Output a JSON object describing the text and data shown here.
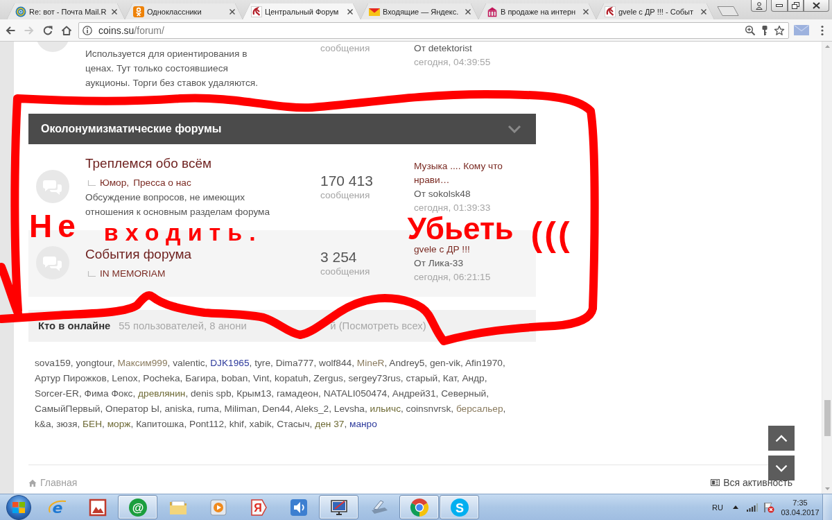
{
  "browser": {
    "tabs": [
      {
        "kind": "mail",
        "title": "Re: вот - Почта Mail.R",
        "selected": false
      },
      {
        "kind": "ok",
        "title": "Одноклассники",
        "selected": false
      },
      {
        "kind": "coins",
        "title": "Центральный Форум",
        "selected": true
      },
      {
        "kind": "ymail",
        "title": "Входящие — Яндекс.",
        "selected": false
      },
      {
        "kind": "shop",
        "title": "В продаже на интерн",
        "selected": false
      },
      {
        "kind": "coins",
        "title": "gvele с ДР !!! - Событ",
        "selected": false
      }
    ],
    "toolbar": {
      "forward_disabled": true,
      "url_host": "coins.su",
      "url_path": "/forum/"
    }
  },
  "page": {
    "previous_forum": {
      "description": "Используется для ориентирования в ценах. Тут только состоявшиеся аукционы. Торги без ставок удаляются.",
      "posts_label": "сообщения",
      "last_author": "От detektorist",
      "last_time": "сегодня, 04:39:55"
    },
    "category": {
      "title": "Околонумизматические форумы",
      "expanded": true
    },
    "forums": [
      {
        "title": "Треплемся обо всём",
        "subforums": [
          "Юмор",
          "Пресса о нас"
        ],
        "description": "Обсуждение вопросов, не имеющих отношения к основным разделам форума",
        "posts": "170 413",
        "posts_label": "сообщения",
        "last_topic": "Музыка .... Кому что нрави…",
        "last_author": "От sokolsk48",
        "last_time": "сегодня, 01:39:33",
        "shaded": false
      },
      {
        "title": "События форума",
        "subforums": [
          "IN MEMORIAM"
        ],
        "posts": "3 254",
        "posts_label": "сообщения",
        "last_topic": "gvele с ДР !!!",
        "last_author": "От Лика-33",
        "last_time": "сегодня, 06:21:15",
        "shaded": true
      }
    ],
    "list_separator": ",",
    "online": {
      "title": "Кто в онлайне",
      "summary_parts": [
        "55 пользователей, 8 анони",
        "й (Посмотреть всех)"
      ],
      "users": [
        {
          "name": "sova159",
          "color": "#555555"
        },
        {
          "name": "yongtour",
          "color": "#555555"
        },
        {
          "name": "Максим999",
          "color": "#8a7b5e"
        },
        {
          "name": "valentic",
          "color": "#555555"
        },
        {
          "name": "DJK1965",
          "color": "#2d3a9c"
        },
        {
          "name": "tyre",
          "color": "#555555"
        },
        {
          "name": "Dima777",
          "color": "#555555"
        },
        {
          "name": "wolf844",
          "color": "#555555"
        },
        {
          "name": "MineR",
          "color": "#8a7b5e"
        },
        {
          "name": "Andrey5",
          "color": "#555555"
        },
        {
          "name": "gen-vik",
          "color": "#555555"
        },
        {
          "name": "Afin1970",
          "color": "#555555"
        },
        {
          "name": "Артур Пирожков",
          "color": "#555555"
        },
        {
          "name": "Lenox",
          "color": "#555555"
        },
        {
          "name": "Pocheka",
          "color": "#555555"
        },
        {
          "name": "Багира",
          "color": "#555555"
        },
        {
          "name": "boban",
          "color": "#555555"
        },
        {
          "name": "Vint",
          "color": "#555555"
        },
        {
          "name": "kopatuh",
          "color": "#555555"
        },
        {
          "name": "Zergus",
          "color": "#555555"
        },
        {
          "name": "sergey73rus",
          "color": "#555555"
        },
        {
          "name": "старый",
          "color": "#555555"
        },
        {
          "name": "Кат",
          "color": "#555555"
        },
        {
          "name": "Андр",
          "color": "#555555"
        },
        {
          "name": "Sorcer-ER",
          "color": "#555555"
        },
        {
          "name": "Фима Фокс",
          "color": "#555555"
        },
        {
          "name": "древлянин",
          "color": "#6e6a35"
        },
        {
          "name": "denis spb",
          "color": "#555555"
        },
        {
          "name": "Крым13",
          "color": "#555555"
        },
        {
          "name": "гамадеон",
          "color": "#555555"
        },
        {
          "name": "NATALI050474",
          "color": "#555555"
        },
        {
          "name": "Андрей31",
          "color": "#555555"
        },
        {
          "name": "Северный",
          "color": "#555555"
        },
        {
          "name": "СамыйПервый",
          "color": "#555555"
        },
        {
          "name": "Оператор Ы",
          "color": "#555555"
        },
        {
          "name": "aniska",
          "color": "#555555"
        },
        {
          "name": "ruma",
          "color": "#555555"
        },
        {
          "name": "Miliman",
          "color": "#555555"
        },
        {
          "name": "Den44",
          "color": "#555555"
        },
        {
          "name": "Aleks_2",
          "color": "#555555"
        },
        {
          "name": "Levsha",
          "color": "#555555"
        },
        {
          "name": "ильичс",
          "color": "#6e6a35"
        },
        {
          "name": "coinsnvrsk",
          "color": "#555555"
        },
        {
          "name": "берсальер",
          "color": "#8a7b5e"
        },
        {
          "name": "k&a",
          "color": "#555555"
        },
        {
          "name": "зюзя",
          "color": "#555555"
        },
        {
          "name": "БЕН",
          "color": "#6e6a35"
        },
        {
          "name": "морж",
          "color": "#6e6a35"
        },
        {
          "name": "Капитошка",
          "color": "#555555"
        },
        {
          "name": "Pont112",
          "color": "#555555"
        },
        {
          "name": "khif",
          "color": "#555555"
        },
        {
          "name": "xabik",
          "color": "#555555"
        },
        {
          "name": "Стасыч",
          "color": "#555555"
        },
        {
          "name": "ден 37",
          "color": "#6e6a35"
        },
        {
          "name": "манро",
          "color": "#2d3a9c"
        }
      ]
    },
    "footer": {
      "home": "Главная",
      "activity": "Вся активность"
    }
  },
  "annotation": {
    "text": "Не входить. Убьеть ((("
  },
  "taskbar": {
    "items": [
      {
        "kind": "ie",
        "glyph": "e",
        "running": false
      },
      {
        "kind": "picture",
        "running": false
      },
      {
        "kind": "agent",
        "glyph": "@",
        "running": true
      },
      {
        "kind": "folder",
        "running": false
      },
      {
        "kind": "player",
        "running": false
      },
      {
        "kind": "yandex",
        "glyph": "Я",
        "running": false
      },
      {
        "kind": "speaker",
        "running": false
      },
      {
        "kind": "paint",
        "running": true
      },
      {
        "kind": "scanner",
        "running": false
      },
      {
        "kind": "chrome",
        "running": true
      },
      {
        "kind": "skype",
        "glyph": "S",
        "running": true
      }
    ],
    "language": "RU",
    "time": "7:35",
    "date": "03.04.2017"
  }
}
